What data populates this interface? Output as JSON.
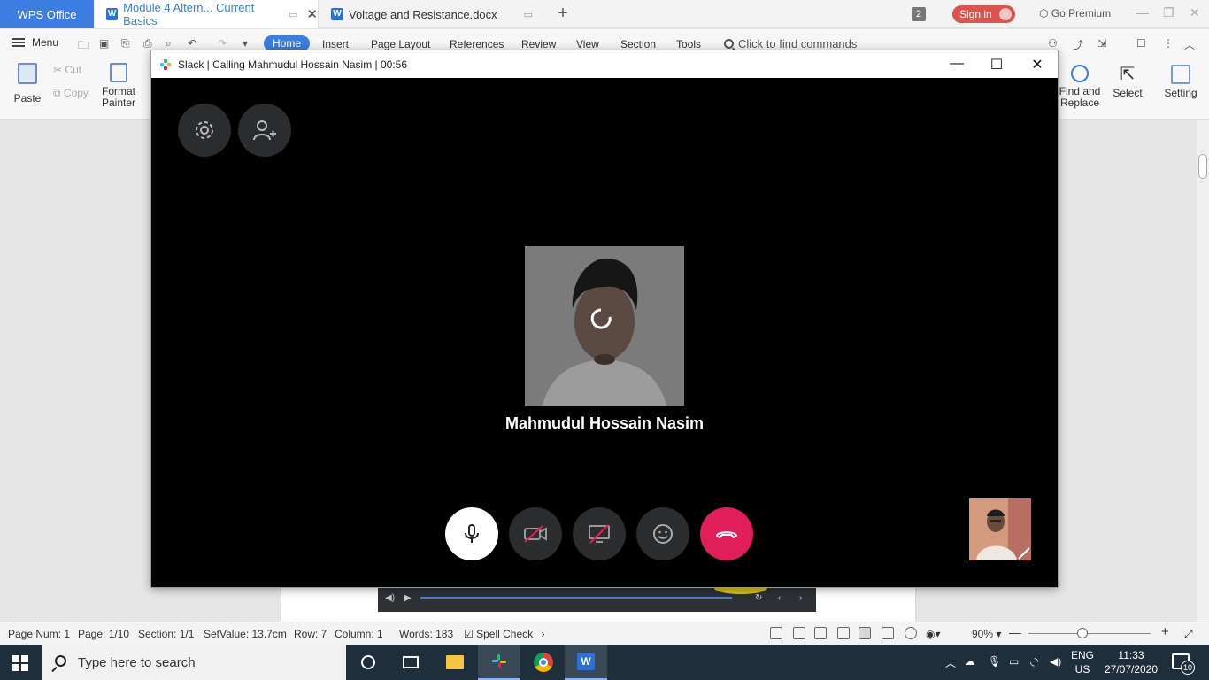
{
  "tabbar": {
    "wps_home": "WPS Office",
    "tabs": [
      {
        "label": "Module 4 Altern... Current Basics",
        "active": true
      },
      {
        "label": "Voltage and Resistance.docx",
        "active": false
      }
    ],
    "tab_count": "2",
    "signin": "Sign in",
    "premium": "Go Premium"
  },
  "menu": {
    "menu_label": "Menu",
    "tabs": [
      "Home",
      "Insert",
      "Page Layout",
      "References",
      "Review",
      "View",
      "Section",
      "Tools"
    ],
    "find_commands": "Click to find commands"
  },
  "ribbon": {
    "paste": "Paste",
    "cut": "Cut",
    "copy": "Copy",
    "format_painter_1": "Format",
    "format_painter_2": "Painter",
    "find_replace_1": "Find and",
    "find_replace_2": "Replace",
    "select": "Select",
    "settings": "Setting"
  },
  "slack": {
    "title": "Slack | Calling Mahmudul Hossain Nasim | 00:56",
    "callee_name": "Mahmudul Hossain Nasim",
    "colors": {
      "hangup": "#e01e5a",
      "button_bg": "#2b2c2e",
      "mic_bg": "#ffffff"
    }
  },
  "status": {
    "page_num": "Page Num: 1",
    "page": "Page: 1/10",
    "section": "Section: 1/1",
    "set_value": "SetValue: 13.7cm",
    "row": "Row: 7",
    "column": "Column: 1",
    "words": "Words: 183",
    "spell_check": "Spell Check",
    "zoom": "90%"
  },
  "taskbar": {
    "search_placeholder": "Type here to search",
    "lang_1": "ENG",
    "lang_2": "US",
    "time": "11:33",
    "date": "27/07/2020",
    "notifications": "10"
  }
}
